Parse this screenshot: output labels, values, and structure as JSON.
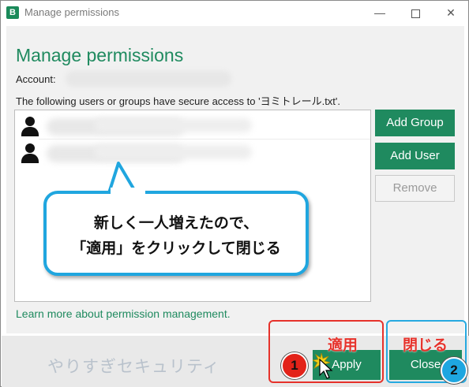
{
  "window": {
    "title": "Manage permissions",
    "app_icon_glyph": "B",
    "controls": {
      "minimize": "—",
      "close": "✕"
    }
  },
  "dialog": {
    "heading": "Manage permissions",
    "account_label": "Account:",
    "description": "The following users or groups have secure access to 'ヨミトレール.txt'.",
    "list_rows": [
      {
        "icon": "user-icon"
      },
      {
        "icon": "user-icon"
      }
    ],
    "buttons": {
      "add_group": "Add Group",
      "add_user": "Add User",
      "remove": "Remove",
      "apply": "Apply",
      "close": "Close"
    },
    "learn_more": "Learn more about permission management."
  },
  "annotation": {
    "bubble_line1": "新しく一人増えたので、",
    "bubble_line2": "「適用」をクリックして閉じる",
    "label_apply": "適用",
    "label_close": "閉じる",
    "badge1": "1",
    "badge2": "2",
    "watermark": "やりすぎセキュリティ"
  },
  "colors": {
    "accent_green": "#1f8a5f",
    "annotation_red": "#e6322b",
    "annotation_blue": "#20a6df"
  }
}
